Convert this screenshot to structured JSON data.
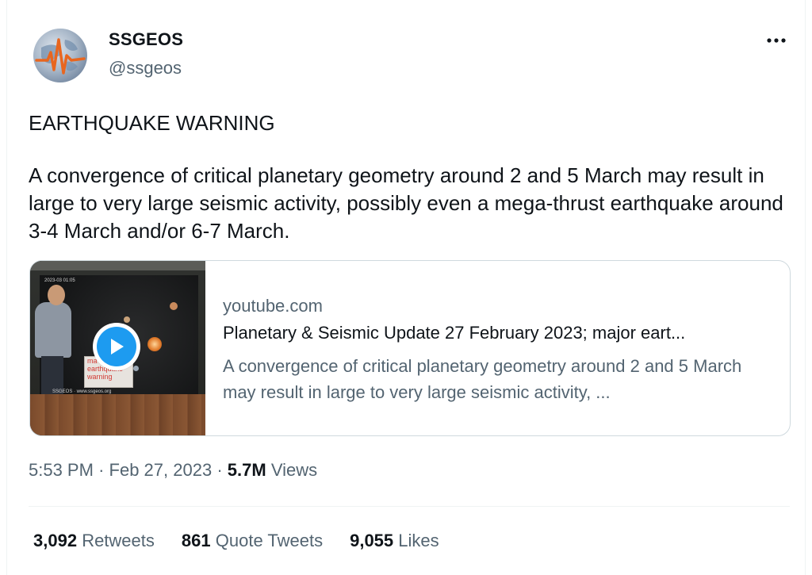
{
  "user": {
    "name": "SSGEOS",
    "handle": "@ssgeos"
  },
  "tweet": {
    "heading": "EARTHQUAKE WARNING",
    "body": "A convergence of critical planetary geometry around 2 and 5 March may result in large to very large seismic activity, possibly even a mega-thrust earthquake around 3-4 March and/or 6-7 March."
  },
  "card": {
    "domain": "youtube.com",
    "title": "Planetary & Seismic Update 27 February 2023; major eart...",
    "description": "A convergence of critical planetary geometry around 2 and 5 March may result in large to very large seismic activity, ...",
    "thumbnail": {
      "timestamp": "2023-03 01:05",
      "warning_text": [
        "ma",
        "earthquake",
        "warning"
      ],
      "footer": "SSGEOS · www.ssgeos.org"
    }
  },
  "meta": {
    "time": "5:53 PM",
    "separator": "·",
    "date": "Feb 27, 2023",
    "views_count": "5.7M",
    "views_label": "Views"
  },
  "stats": {
    "retweets_count": "3,092",
    "retweets_label": "Retweets",
    "quotes_count": "861",
    "quotes_label": "Quote Tweets",
    "likes_count": "9,055",
    "likes_label": "Likes"
  },
  "icons": {
    "more": "more-options-icon",
    "play": "play-icon"
  },
  "colors": {
    "accent": "#1d9bf0",
    "secondary_text": "#536471",
    "primary_text": "#0f1419",
    "border": "#cfd9de"
  }
}
